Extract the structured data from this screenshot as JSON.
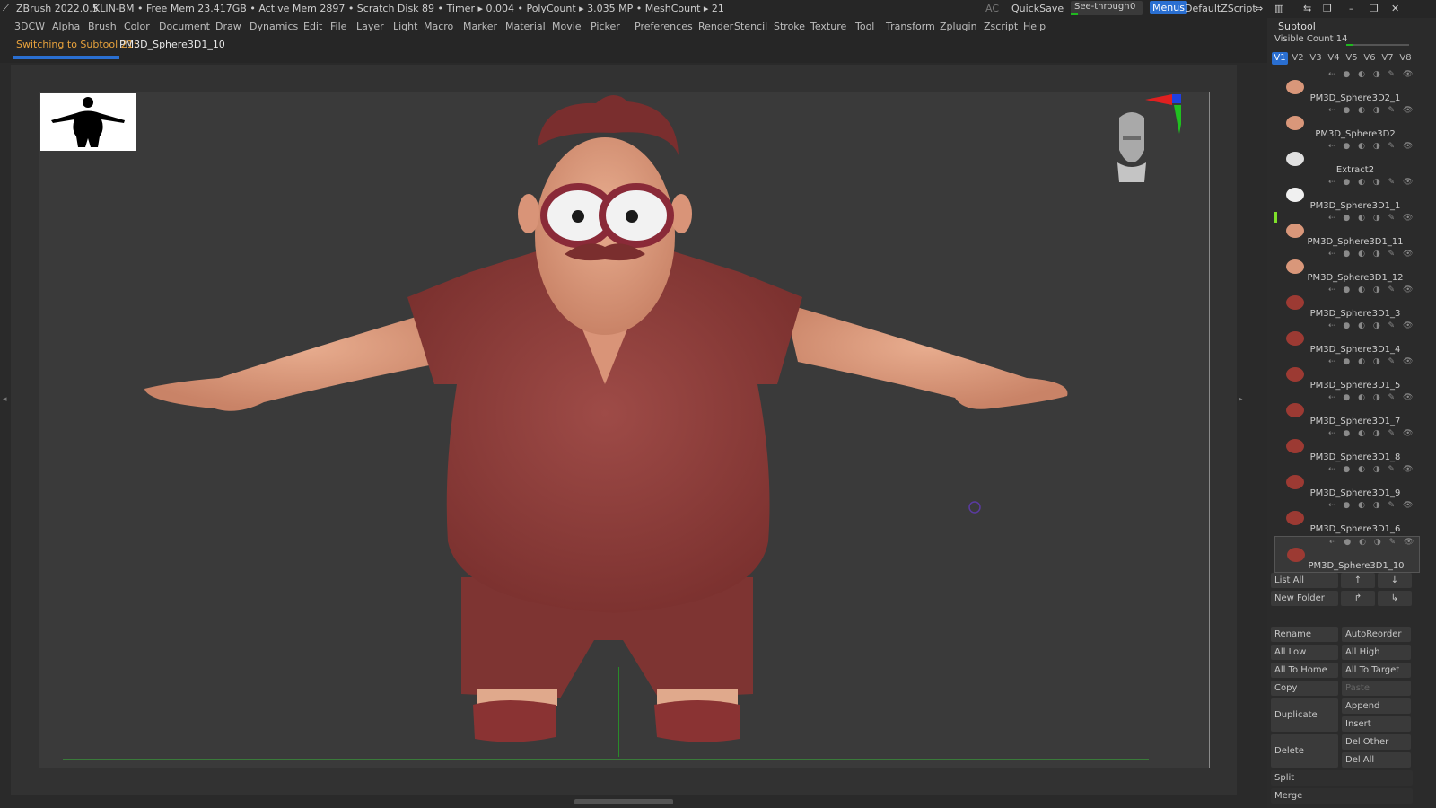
{
  "topbar": {
    "app_title": "ZBrush 2022.0.5",
    "host": "KLIN-BM",
    "stats": "• Free Mem 23.417GB • Active Mem 2897 • Scratch Disk 89 • Timer ▸ 0.004 • PolyCount ▸ 3.035 MP • MeshCount ▸ 21",
    "ac": "AC",
    "quicksave": "QuickSave",
    "seethrough": "See-through",
    "seethrough_value": "0",
    "menus": "Menus",
    "script": "DefaultZScript"
  },
  "menus": [
    "3DCW",
    "Alpha",
    "Brush",
    "Color",
    "Document",
    "Draw",
    "Dynamics",
    "Edit",
    "File",
    "Layer",
    "Light",
    "Macro",
    "Marker",
    "Material",
    "Movie",
    "Picker",
    "Preferences",
    "Render",
    "Stencil",
    "Stroke",
    "Texture",
    "Tool",
    "Transform",
    "Zplugin",
    "Zscript",
    "Help"
  ],
  "notice": {
    "label": "Switching to Subtool 21:",
    "name": "PM3D_Sphere3D1_10"
  },
  "subtool": {
    "title": "Subtool",
    "visible_count": "Visible Count 14",
    "tabs": [
      "V1",
      "V2",
      "V3",
      "V4",
      "V5",
      "V6",
      "V7",
      "V8"
    ],
    "items": [
      {
        "name": "PM3D_Sphere3D2_1",
        "color": "#d9977a"
      },
      {
        "name": "PM3D_Sphere3D2",
        "color": "#d9977a"
      },
      {
        "name": "Extract2",
        "color": "#e0e0e0"
      },
      {
        "name": "PM3D_Sphere3D1_1",
        "color": "#f0f0f0"
      },
      {
        "name": "PM3D_Sphere3D1_11",
        "color": "#d9977a"
      },
      {
        "name": "PM3D_Sphere3D1_12",
        "color": "#d9977a"
      },
      {
        "name": "PM3D_Sphere3D1_3",
        "color": "#9c3a33"
      },
      {
        "name": "PM3D_Sphere3D1_4",
        "color": "#9c3a33"
      },
      {
        "name": "PM3D_Sphere3D1_5",
        "color": "#9c3a33"
      },
      {
        "name": "PM3D_Sphere3D1_7",
        "color": "#9c3a33"
      },
      {
        "name": "PM3D_Sphere3D1_8",
        "color": "#9c3a33"
      },
      {
        "name": "PM3D_Sphere3D1_9",
        "color": "#9c3a33"
      },
      {
        "name": "PM3D_Sphere3D1_6",
        "color": "#9c3a33"
      },
      {
        "name": "PM3D_Sphere3D1_10",
        "color": "#9c3a33"
      }
    ],
    "list_all": "List All",
    "new_folder": "New Folder",
    "rename": "Rename",
    "autoreorder": "AutoReorder",
    "all_low": "All Low",
    "all_high": "All High",
    "all_to_home": "All To Home",
    "all_to_target": "All To Target",
    "copy": "Copy",
    "paste": "Paste",
    "duplicate": "Duplicate",
    "append": "Append",
    "insert": "Insert",
    "delete": "Delete",
    "del_other": "Del Other",
    "del_all": "Del All",
    "split": "Split",
    "merge": "Merge"
  },
  "colors": {
    "accent": "#2a6fd1",
    "notice": "#e8a23c",
    "shirt": "#8c3b3a",
    "skin": "#d9977a"
  }
}
